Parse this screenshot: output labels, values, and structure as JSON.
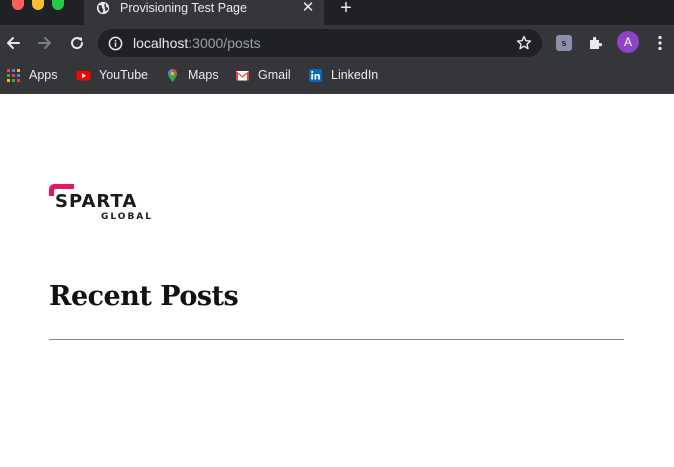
{
  "browser": {
    "tab": {
      "title": "Provisioning Test Page",
      "close_label": "✕"
    },
    "new_tab_label": "+",
    "url": {
      "host": "localhost",
      "rest": ":3000/posts"
    },
    "extension_label": "s",
    "avatar_initial": "A",
    "bookmarks": [
      {
        "label": "Apps",
        "icon": "apps-grid-icon"
      },
      {
        "label": "YouTube",
        "icon": "youtube-icon"
      },
      {
        "label": "Maps",
        "icon": "maps-icon"
      },
      {
        "label": "Gmail",
        "icon": "gmail-icon"
      },
      {
        "label": "LinkedIn",
        "icon": "linkedin-icon"
      }
    ]
  },
  "page": {
    "logo": {
      "text_main": "SPARTA",
      "text_sub": "GLOBAL",
      "accent_color": "#e6175c"
    },
    "heading": "Recent Posts"
  },
  "colors": {
    "chrome_dark": "#202124",
    "chrome_toolbar": "#35363a",
    "avatar": "#8e44c7"
  }
}
